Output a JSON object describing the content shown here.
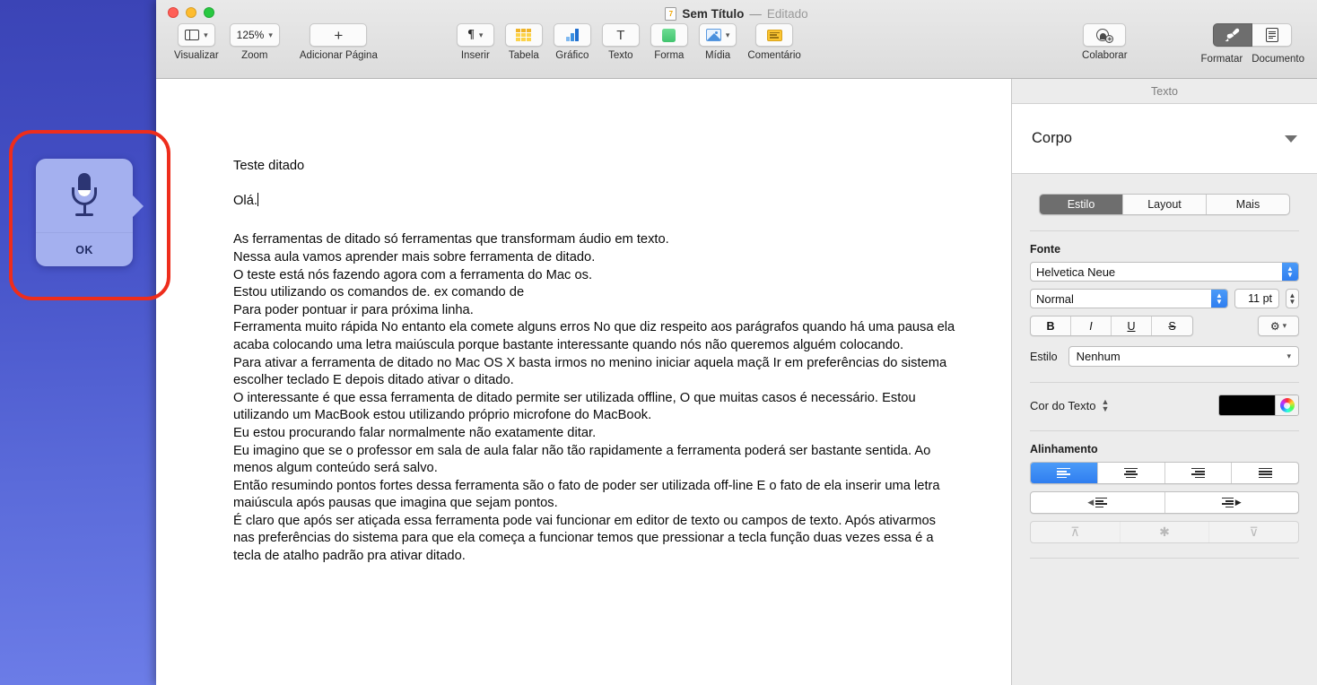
{
  "window": {
    "title_strong": "Sem Título",
    "title_separator": "—",
    "title_status": "Editado",
    "doc_icon": "pages-document-icon"
  },
  "toolbar": {
    "left": [
      {
        "label": "Visualizar",
        "icon": "view-panes-icon",
        "has_chevron": true
      },
      {
        "label": "Zoom",
        "icon": "zoom-level",
        "value": "125%",
        "has_chevron": true
      },
      {
        "label": "Adicionar Página",
        "icon": "plus-icon",
        "has_chevron": false
      }
    ],
    "center": [
      {
        "label": "Inserir",
        "icon": "pilcrow-icon",
        "has_chevron": true
      },
      {
        "label": "Tabela",
        "icon": "table-icon",
        "has_chevron": false
      },
      {
        "label": "Gráfico",
        "icon": "bar-chart-icon",
        "has_chevron": false
      },
      {
        "label": "Texto",
        "icon": "text-t-icon",
        "has_chevron": false
      },
      {
        "label": "Forma",
        "icon": "shape-square-icon",
        "has_chevron": false
      },
      {
        "label": "Mídia",
        "icon": "media-image-icon",
        "has_chevron": true
      },
      {
        "label": "Comentário",
        "icon": "comment-note-icon",
        "has_chevron": false
      }
    ],
    "right": [
      {
        "label": "Colaborar",
        "icon": "collaborate-person-add-icon"
      }
    ],
    "segmented": [
      {
        "label": "Formatar",
        "icon": "paintbrush-icon",
        "selected": true
      },
      {
        "label": "Documento",
        "icon": "document-page-icon",
        "selected": false
      }
    ]
  },
  "dictation": {
    "mic_icon": "microphone-icon",
    "ok_label": "OK",
    "highlight_color": "#ee2d1c"
  },
  "document": {
    "lines": [
      "Teste ditado",
      "",
      "Olá.",
      "",
      "As ferramentas de ditado só ferramentas que transformam áudio em texto.",
      "Nessa aula vamos aprender mais sobre ferramenta de ditado.",
      "O teste está nós fazendo agora com a ferramenta do Mac os.",
      "Estou utilizando os comandos de. ex comando de",
      "Para poder pontuar ir para próxima linha.",
      "Ferramenta muito rápida No entanto ela comete alguns erros No que diz respeito aos parágrafos quando há uma pausa ela acaba colocando uma letra maiúscula porque bastante interessante quando nós não queremos alguém colocando.",
      "Para ativar a ferramenta de ditado no Mac OS X basta irmos no menino iniciar aquela maçã Ir em preferências do sistema escolher teclado E depois ditado ativar o ditado.",
      "O interessante é que essa ferramenta de ditado permite ser utilizada offline, O que muitas casos é necessário. Estou utilizando um MacBook estou utilizando próprio microfone do MacBook.",
      "Eu estou procurando falar normalmente não exatamente ditar.",
      "Eu imagino que se o professor em sala de aula falar não tão rapidamente a ferramenta poderá ser bastante sentida. Ao menos algum conteúdo será salvo.",
      "Então resumindo pontos fortes dessa ferramenta são o fato de poder ser utilizada off-line E o fato de ela inserir uma letra maiúscula após pausas que imagina que sejam pontos.",
      "É claro que após ser atiçada essa ferramenta pode vai funcionar em editor de texto ou campos de texto. Após ativarmos nas preferências do sistema para que ela começa a funcionar temos que pressionar a tecla função duas vezes essa é a tecla de atalho padrão pra ativar ditado."
    ]
  },
  "inspector": {
    "header": "Texto",
    "paragraph_style": "Corpo",
    "tabs": [
      {
        "label": "Estilo",
        "active": true
      },
      {
        "label": "Layout",
        "active": false
      },
      {
        "label": "Mais",
        "active": false
      }
    ],
    "font_section_title": "Fonte",
    "font_family": "Helvetica Neue",
    "font_weight": "Normal",
    "font_size": "11 pt",
    "style_buttons": [
      {
        "label": "B",
        "name": "bold"
      },
      {
        "label": "I",
        "name": "italic"
      },
      {
        "label": "U",
        "name": "underline"
      },
      {
        "label": "S",
        "name": "strikethrough"
      }
    ],
    "gear_label": "gear-options",
    "character_style_label": "Estilo",
    "character_style_value": "Nenhum",
    "text_color_label": "Cor do Texto",
    "text_color_value": "#000000",
    "alignment_title": "Alinhamento",
    "alignment_buttons": [
      {
        "name": "align-left",
        "active": true
      },
      {
        "name": "align-center",
        "active": false
      },
      {
        "name": "align-right",
        "active": false
      },
      {
        "name": "align-justify",
        "active": false
      }
    ],
    "indent_buttons": [
      {
        "name": "decrease-indent"
      },
      {
        "name": "increase-indent"
      }
    ],
    "vertical_align_buttons": [
      {
        "name": "align-top",
        "disabled": true
      },
      {
        "name": "align-middle",
        "disabled": true
      },
      {
        "name": "align-bottom",
        "disabled": true
      }
    ]
  }
}
